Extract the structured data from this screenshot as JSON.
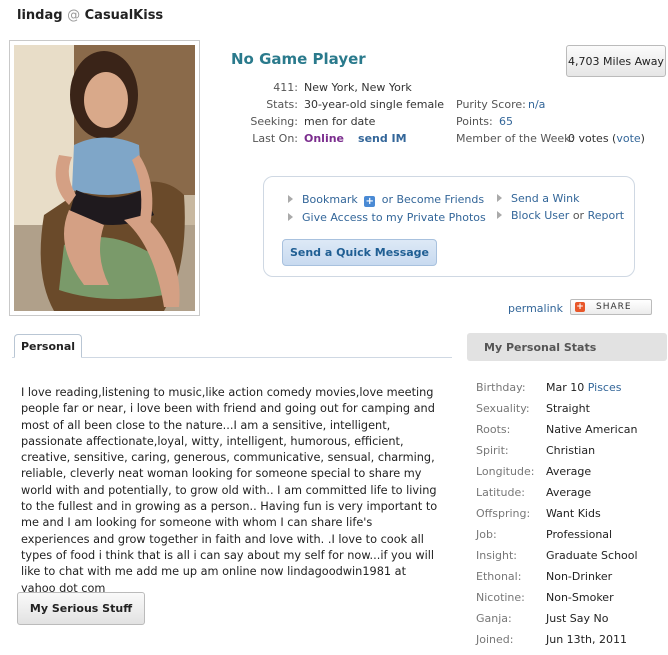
{
  "header": {
    "username": "lindag",
    "at": "@",
    "site": "CasualKiss"
  },
  "profile": {
    "headline": "No Game Player",
    "distance": "4,703 Miles Away",
    "rows": [
      {
        "label": "411:",
        "value": "New York, New York"
      },
      {
        "label": "Stats:",
        "value": "30-year-old single female"
      },
      {
        "label": "Seeking:",
        "value": "men for date"
      },
      {
        "label": "Last On:",
        "value": "Online",
        "extra": "send IM"
      }
    ],
    "right_rows": [
      {
        "label": "Purity Score:",
        "value": "n/a"
      },
      {
        "label": "Points:",
        "value": "65"
      },
      {
        "label": "Member of the Week:",
        "value": "0 votes",
        "extra": "vote"
      }
    ]
  },
  "actions": {
    "bookmark": "Bookmark",
    "or_become": "or Become Friends",
    "give_access": "Give Access to my Private Photos",
    "send_wink": "Send a Wink",
    "block": "Block User",
    "or_text": "or",
    "report": "Report",
    "quick_message": "Send a Quick Message"
  },
  "permalink": "permalink",
  "share": "SHARE",
  "tabs": {
    "personal": "Personal"
  },
  "about_text": "I love reading,listening to music,like action comedy movies,love meeting people far or near, i love been with friend and going out for camping and most of all been close to the nature...I am a sensitive, intelligent, passionate affectionate,loyal, witty, intelligent, humorous, efficient, creative, sensitive, caring, generous, communicative, sensual, charming, reliable, cleverly neat woman looking for someone special to share my world with and potentially, to grow old with.. I am committed life to living to the fullest and in growing as a person.. Having fun is very important to me and I am looking for someone with whom I can share life's experiences and grow together in faith and love with. .I love to cook all types of food i think that is all i can say about my self for now...if you will like to chat with me add me up am online now lindagoodwin1981 at yahoo dot com",
  "serious_button": "My Serious Stuff",
  "stats": {
    "header": "My Personal Stats",
    "items": [
      {
        "label": "Birthday:",
        "value": "Mar 10",
        "extra": "Pisces"
      },
      {
        "label": "Sexuality:",
        "value": "Straight"
      },
      {
        "label": "Roots:",
        "value": "Native American"
      },
      {
        "label": "Spirit:",
        "value": "Christian"
      },
      {
        "label": "Longitude:",
        "value": "Average"
      },
      {
        "label": "Latitude:",
        "value": "Average"
      },
      {
        "label": "Offspring:",
        "value": "Want Kids"
      },
      {
        "label": "Job:",
        "value": "Professional"
      },
      {
        "label": "Insight:",
        "value": "Graduate School"
      },
      {
        "label": "Ethonal:",
        "value": "Non-Drinker"
      },
      {
        "label": "Nicotine:",
        "value": "Non-Smoker"
      },
      {
        "label": "Ganja:",
        "value": "Just Say No"
      },
      {
        "label": "Joined:",
        "value": "Jun 13th, 2011"
      }
    ]
  }
}
